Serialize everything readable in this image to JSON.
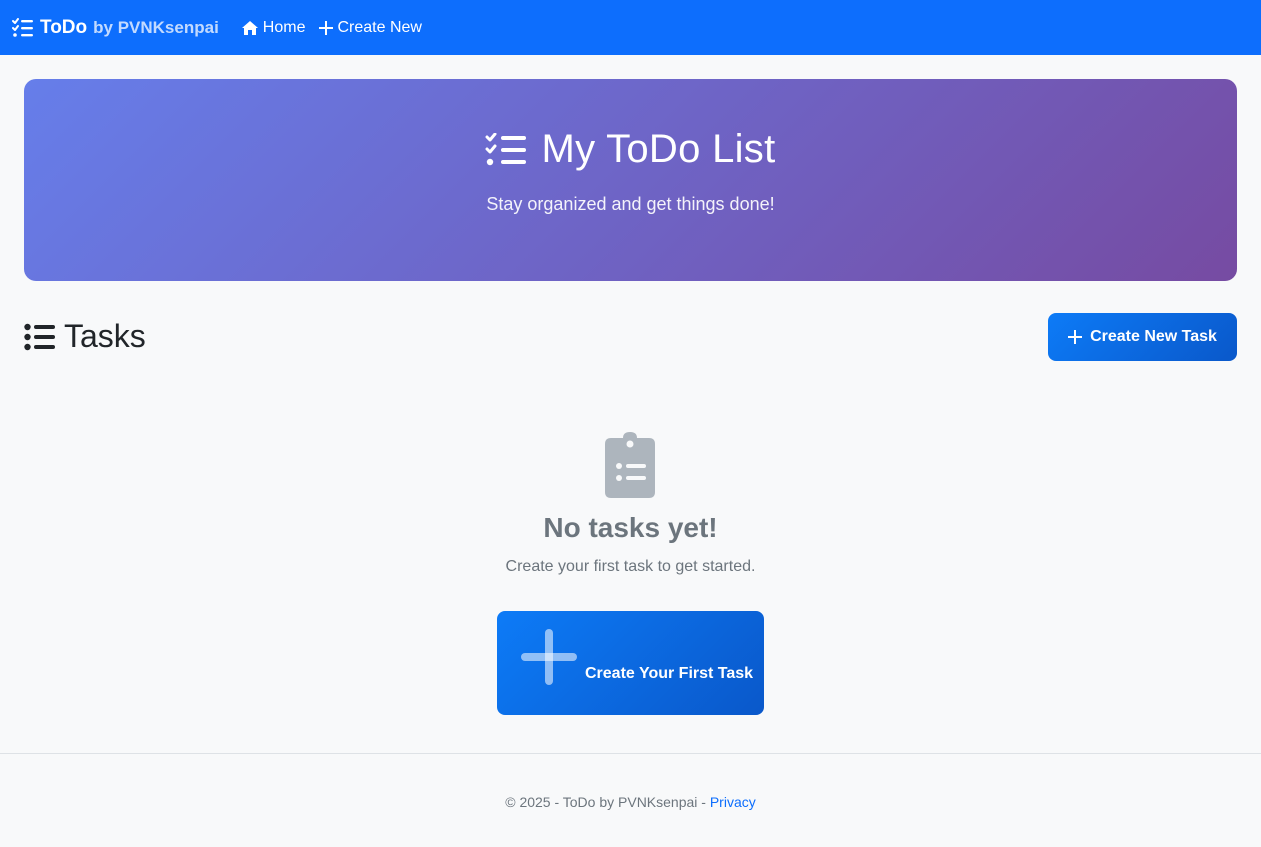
{
  "navbar": {
    "brand_main": "ToDo",
    "brand_sub": "by PVNKsenpai",
    "brand_icon": "list-check-icon",
    "links": [
      {
        "label": "Home",
        "icon": "house-icon"
      },
      {
        "label": "Create New",
        "icon": "plus-icon"
      }
    ],
    "color": "#0d6efd"
  },
  "hero": {
    "title": "My ToDo List",
    "subtitle": "Stay organized and get things done!",
    "icon": "list-check-icon",
    "gradient": [
      "#667eea",
      "#764ba2"
    ]
  },
  "tasks": {
    "heading": "Tasks",
    "heading_icon": "list-ul-icon",
    "create_button": "Create New Task"
  },
  "empty_state": {
    "icon": "clipboard-list-icon",
    "title": "No tasks yet!",
    "text": "Create your first task to get started.",
    "button": "Create Your First Task"
  },
  "footer": {
    "text": "© 2025 - ToDo by PVNKsenpai -",
    "privacy_link": "Privacy"
  }
}
